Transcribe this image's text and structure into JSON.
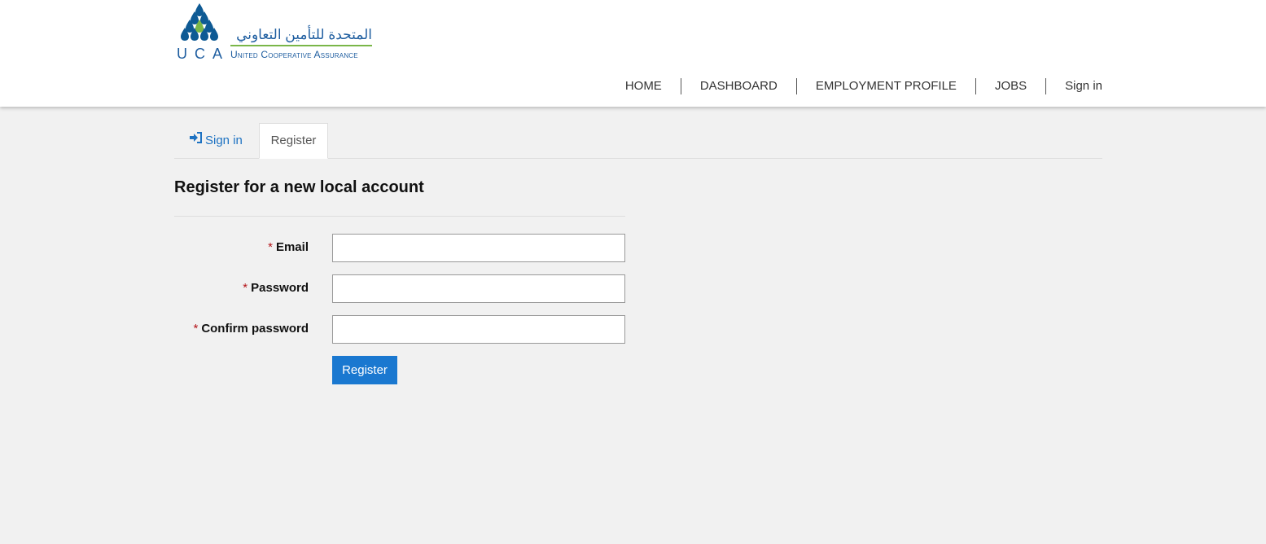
{
  "logo": {
    "letters": [
      "U",
      "C",
      "A"
    ],
    "arabic": "المتحدة للتأمين التعاوني",
    "english": "United Cooperative Assurance",
    "colors": {
      "blue": "#0e5a94",
      "green": "#7ab648"
    }
  },
  "nav": {
    "items": [
      {
        "label": "HOME"
      },
      {
        "label": "DASHBOARD"
      },
      {
        "label": "EMPLOYMENT PROFILE"
      },
      {
        "label": "JOBS"
      },
      {
        "label": "Sign in"
      }
    ]
  },
  "tabs": {
    "signin": {
      "label": "Sign in",
      "icon": "sign-in-icon"
    },
    "register": {
      "label": "Register"
    }
  },
  "form": {
    "title": "Register for a new local account",
    "required_marker": "*",
    "email": {
      "label": "Email",
      "value": ""
    },
    "password": {
      "label": "Password",
      "value": ""
    },
    "confirm": {
      "label": "Confirm password",
      "value": ""
    },
    "submit_label": "Register"
  },
  "theme": {
    "accent": "#1a78d0",
    "link": "#1d72c2",
    "required": "#b4151a",
    "background": "#f1f1f1"
  }
}
